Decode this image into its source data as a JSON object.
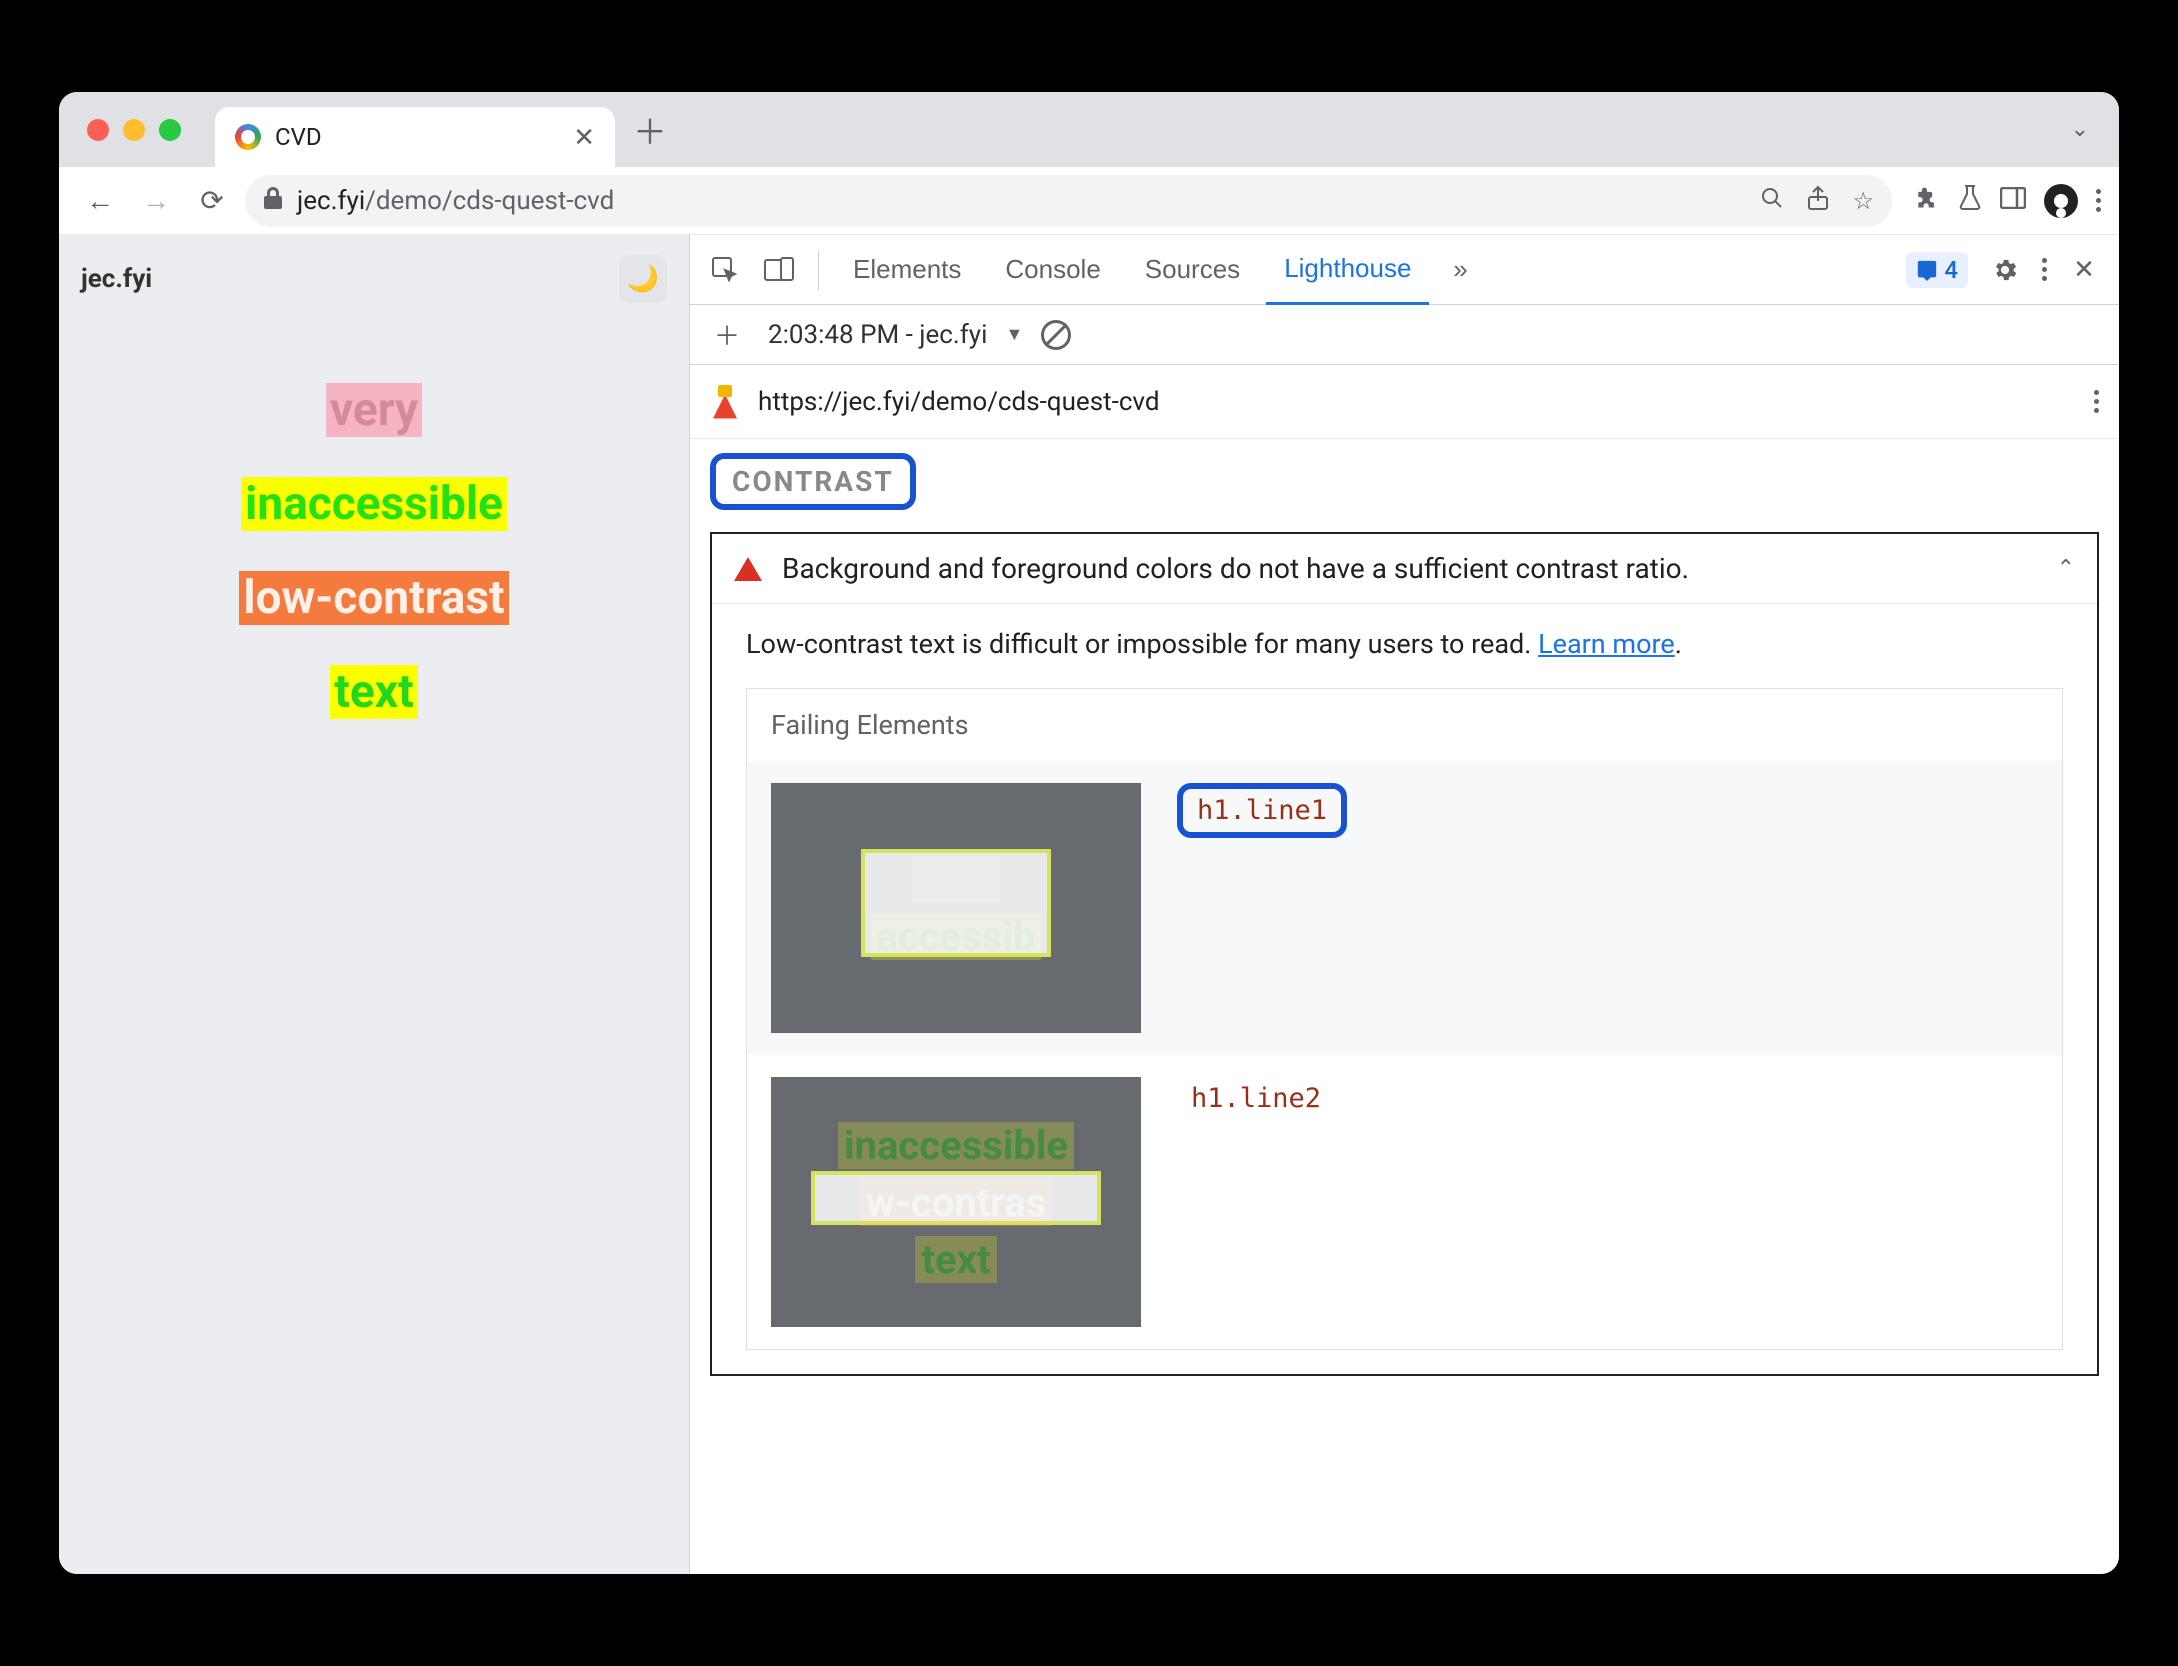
{
  "browser": {
    "tab_title": "CVD",
    "url_display_prefix": "jec.fyi",
    "url_display_rest": "/demo/cds-quest-cvd"
  },
  "page": {
    "site_name": "jec.fyi",
    "lines": {
      "l1": "very",
      "l2": "inaccessible",
      "l3": "low-contrast",
      "l4": "text"
    }
  },
  "devtools": {
    "tabs": {
      "elements": "Elements",
      "console": "Console",
      "sources": "Sources",
      "lighthouse": "Lighthouse"
    },
    "insights_count": "4",
    "run_label": "2:03:48 PM - jec.fyi",
    "lh_url": "https://jec.fyi/demo/cds-quest-cvd",
    "section": "CONTRAST",
    "audit": {
      "title": "Background and foreground colors do not have a sufficient contrast ratio.",
      "desc_pre": "Low-contrast text is difficult or impossible for many users to read. ",
      "desc_link": "Learn more",
      "desc_post": "."
    },
    "failing_label": "Failing Elements",
    "failing": [
      {
        "selector": "h1.line1"
      },
      {
        "selector": "h1.line2"
      }
    ]
  }
}
